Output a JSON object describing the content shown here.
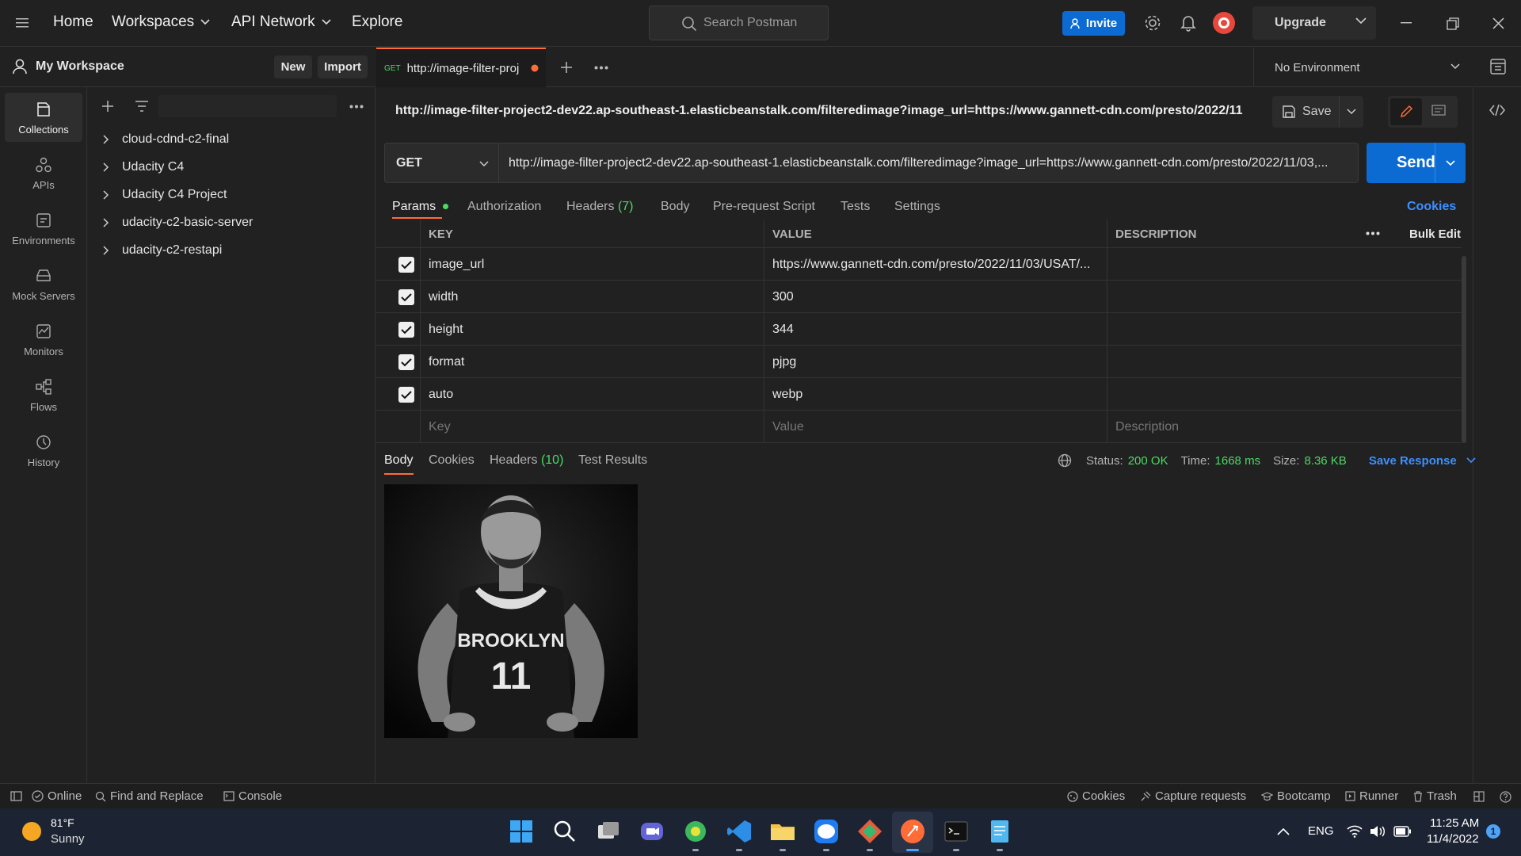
{
  "topbar": {
    "nav": [
      "Home",
      "Workspaces",
      "API Network",
      "Explore"
    ],
    "search_placeholder": "Search Postman",
    "invite_label": "Invite",
    "upgrade_label": "Upgrade"
  },
  "workspace": {
    "name": "My Workspace",
    "new_label": "New",
    "import_label": "Import"
  },
  "rail": {
    "items": [
      "Collections",
      "APIs",
      "Environments",
      "Mock Servers",
      "Monitors",
      "Flows",
      "History"
    ]
  },
  "collections": [
    "cloud-cdnd-c2-final",
    "Udacity C4",
    "Udacity C4 Project",
    "udacity-c2-basic-server",
    "udacity-c2-restapi"
  ],
  "tab": {
    "method": "GET",
    "title": "http://image-filter-proj",
    "environment": "No Environment"
  },
  "request": {
    "title_url": "http://image-filter-project2-dev22.ap-southeast-1.elasticbeanstalk.com/filteredimage?image_url=https://www.gannett-cdn.com/presto/2022/11...",
    "save_label": "Save",
    "method": "GET",
    "url": "http://image-filter-project2-dev22.ap-southeast-1.elasticbeanstalk.com/filteredimage?image_url=https://www.gannett-cdn.com/presto/2022/11/03,...",
    "send_label": "Send",
    "tabs": {
      "params": "Params",
      "authorization": "Authorization",
      "headers": "Headers",
      "headers_count": "(7)",
      "body": "Body",
      "prerequest": "Pre-request Script",
      "tests": "Tests",
      "settings": "Settings",
      "cookies": "Cookies"
    }
  },
  "params": {
    "headers": {
      "key": "KEY",
      "value": "VALUE",
      "description": "DESCRIPTION",
      "bulk_edit": "Bulk Edit"
    },
    "rows": [
      {
        "key": "image_url",
        "value": "https://www.gannett-cdn.com/presto/2022/11/03/USAT/..."
      },
      {
        "key": "width",
        "value": "300"
      },
      {
        "key": "height",
        "value": "344"
      },
      {
        "key": "format",
        "value": "pjpg"
      },
      {
        "key": "auto",
        "value": "webp"
      }
    ],
    "placeholders": {
      "key": "Key",
      "value": "Value",
      "description": "Description"
    }
  },
  "response": {
    "tabs": {
      "body": "Body",
      "cookies": "Cookies",
      "headers": "Headers",
      "headers_count": "(10)",
      "tests": "Test Results"
    },
    "status_label": "Status:",
    "status_value": "200 OK",
    "time_label": "Time:",
    "time_value": "1668 ms",
    "size_label": "Size:",
    "size_value": "8.36 KB",
    "save_response": "Save Response",
    "jersey_text": "BROOKLYN",
    "jersey_number": "11"
  },
  "statusbar": {
    "online": "Online",
    "find_replace": "Find and Replace",
    "console": "Console",
    "cookies": "Cookies",
    "capture": "Capture requests",
    "bootcamp": "Bootcamp",
    "runner": "Runner",
    "trash": "Trash"
  },
  "taskbar": {
    "temp": "81°F",
    "weather": "Sunny",
    "lang": "ENG",
    "time": "11:25 AM",
    "date": "11/4/2022",
    "notif_count": "1"
  },
  "colors": {
    "accent_orange": "#ff6c37",
    "primary_blue": "#0b6bd3",
    "link_blue": "#3d8fff",
    "success_green": "#4cd964"
  }
}
